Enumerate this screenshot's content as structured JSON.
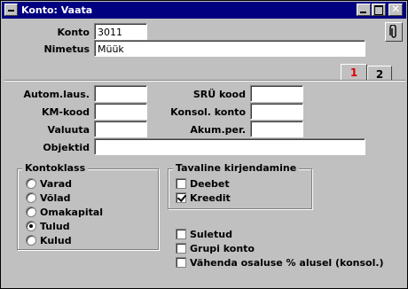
{
  "window": {
    "title": "Konto: Vaata"
  },
  "header": {
    "konto_label": "Konto",
    "konto_value": "3011",
    "nimetus_label": "Nimetus",
    "nimetus_value": "Müük"
  },
  "tabs": [
    {
      "label": "1",
      "active": true
    },
    {
      "label": "2",
      "active": false
    }
  ],
  "fields": {
    "autom_laus_label": "Autom.laus.",
    "autom_laus_value": "",
    "km_kood_label": "KM-kood",
    "km_kood_value": "",
    "valuuta_label": "Valuuta",
    "valuuta_value": "",
    "objektid_label": "Objektid",
    "objektid_value": "",
    "sru_kood_label": "SRÜ kood",
    "sru_kood_value": "",
    "konsol_konto_label": "Konsol. konto",
    "konsol_konto_value": "",
    "akum_per_label": "Akum.per.",
    "akum_per_value": ""
  },
  "kontoklass": {
    "title": "Kontoklass",
    "options": [
      {
        "label": "Varad",
        "selected": false
      },
      {
        "label": "Võlad",
        "selected": false
      },
      {
        "label": "Omakapital",
        "selected": false
      },
      {
        "label": "Tulud",
        "selected": true
      },
      {
        "label": "Kulud",
        "selected": false
      }
    ]
  },
  "kirjendamine": {
    "title": "Tavaline kirjendamine",
    "options": [
      {
        "label": "Deebet",
        "checked": false
      },
      {
        "label": "Kreedit",
        "checked": true
      }
    ]
  },
  "flags": [
    {
      "label": "Suletud",
      "checked": false
    },
    {
      "label": "Grupi konto",
      "checked": false
    },
    {
      "label": "Vähenda osaluse % alusel (konsol.)",
      "checked": false
    }
  ],
  "icons": {
    "system": "system-menu-icon",
    "attach": "paperclip-icon"
  }
}
